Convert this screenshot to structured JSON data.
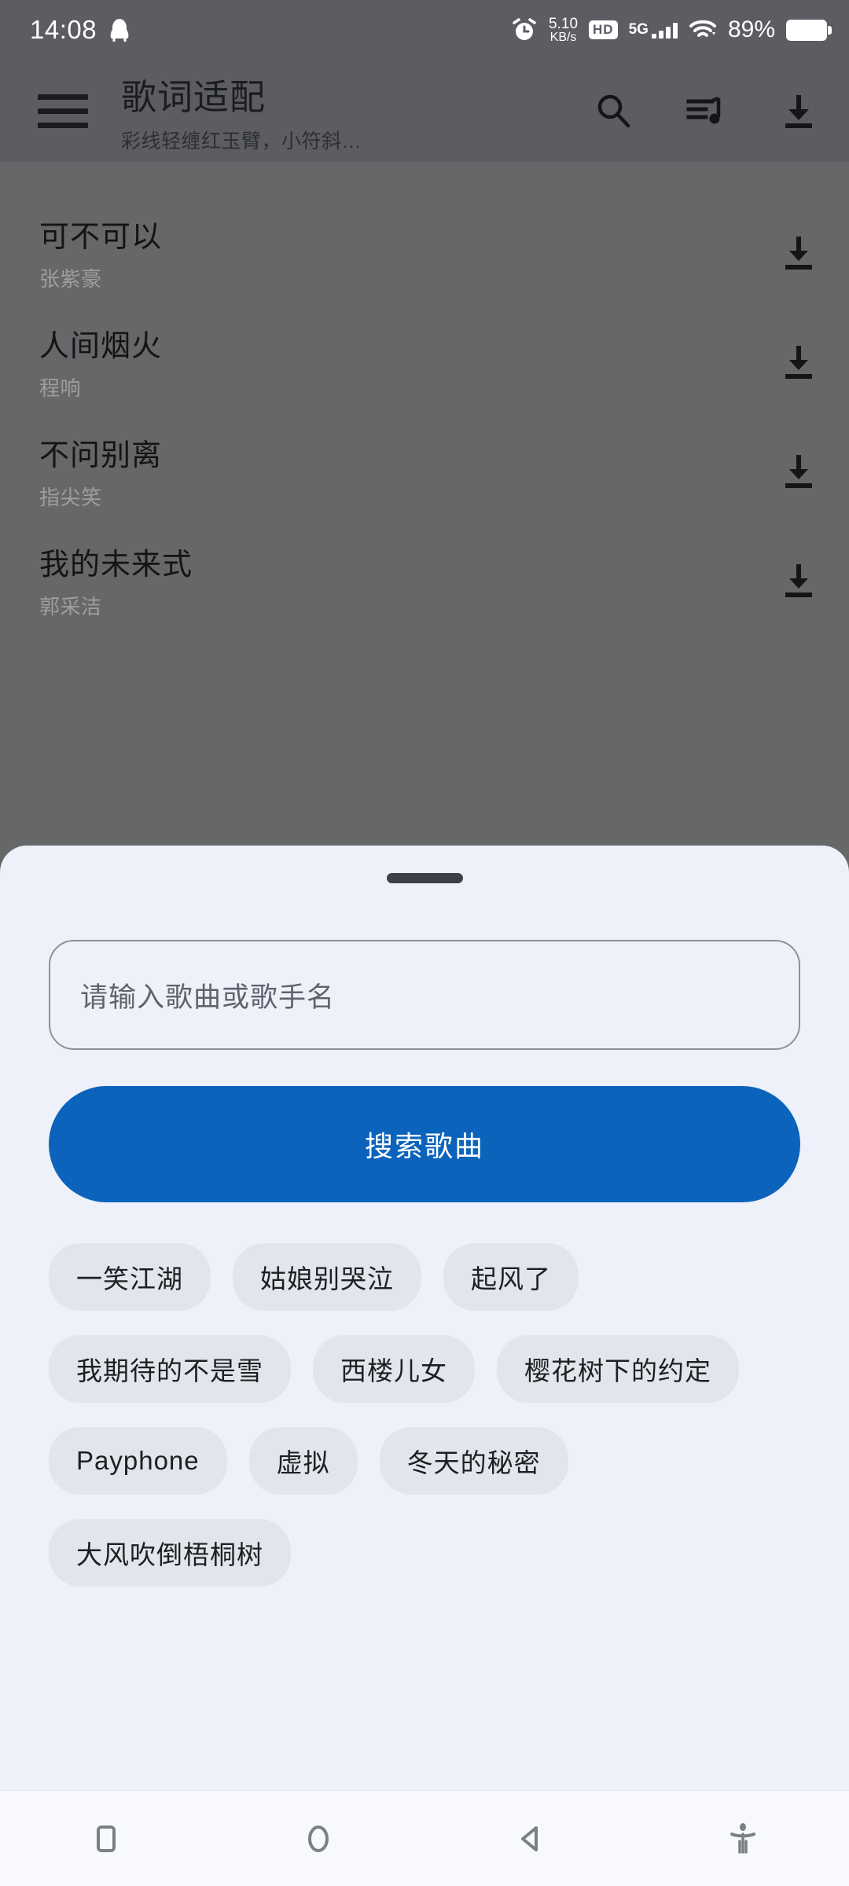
{
  "status_bar": {
    "time": "14:08",
    "qq_icon": "qq-penguin-icon",
    "alarm_icon": "alarm-clock-icon",
    "net_speed_value": "5.10",
    "net_speed_unit": "KB/s",
    "hd_badge": "HD",
    "network_type": "5G",
    "signal_icon": "signal-bars-icon",
    "wifi_icon": "wifi-icon",
    "battery_percent": "89%",
    "battery_icon": "battery-icon"
  },
  "app_bar": {
    "menu_icon": "hamburger-menu-icon",
    "title": "歌词适配",
    "subtitle": "彩线轻缠红玉臂，小符斜…",
    "actions": [
      {
        "name": "search-icon",
        "label": "搜索"
      },
      {
        "name": "queue-music-icon",
        "label": "播放列表"
      },
      {
        "name": "download-icon",
        "label": "下载"
      }
    ]
  },
  "song_list": {
    "rows": [
      {
        "title": "可不可以",
        "artist": "张紫豪",
        "action_icon": "download-icon"
      },
      {
        "title": "人间烟火",
        "artist": "程响",
        "action_icon": "download-icon"
      },
      {
        "title": "不问别离",
        "artist": "指尖笑",
        "action_icon": "download-icon"
      },
      {
        "title": "我的未来式",
        "artist": "郭采洁",
        "action_icon": "download-icon"
      }
    ]
  },
  "sheet": {
    "handle_icon": "drag-handle",
    "search_field": {
      "value": "",
      "placeholder": "请输入歌曲或歌手名"
    },
    "search_button_label": "搜索歌曲",
    "suggestion_chips": [
      "一笑江湖",
      "姑娘别哭泣",
      "起风了",
      "我期待的不是雪",
      "西楼儿女",
      "樱花树下的约定",
      "Payphone",
      "虚拟",
      "冬天的秘密",
      "大风吹倒梧桐树"
    ]
  },
  "nav_bar": {
    "buttons": [
      {
        "name": "recents-button",
        "icon": "square-icon"
      },
      {
        "name": "home-button",
        "icon": "circle-icon"
      },
      {
        "name": "back-button",
        "icon": "triangle-left-icon"
      },
      {
        "name": "accessibility-button",
        "icon": "accessibility-icon"
      }
    ]
  },
  "colors": {
    "scrim": "#666769",
    "app_bar": "#5B5D62",
    "sheet_bg": "#EEF1F9",
    "accent_blue": "#0B63BC",
    "chip_bg": "#E2E5EB",
    "nav_bg": "#F7F9FC"
  }
}
